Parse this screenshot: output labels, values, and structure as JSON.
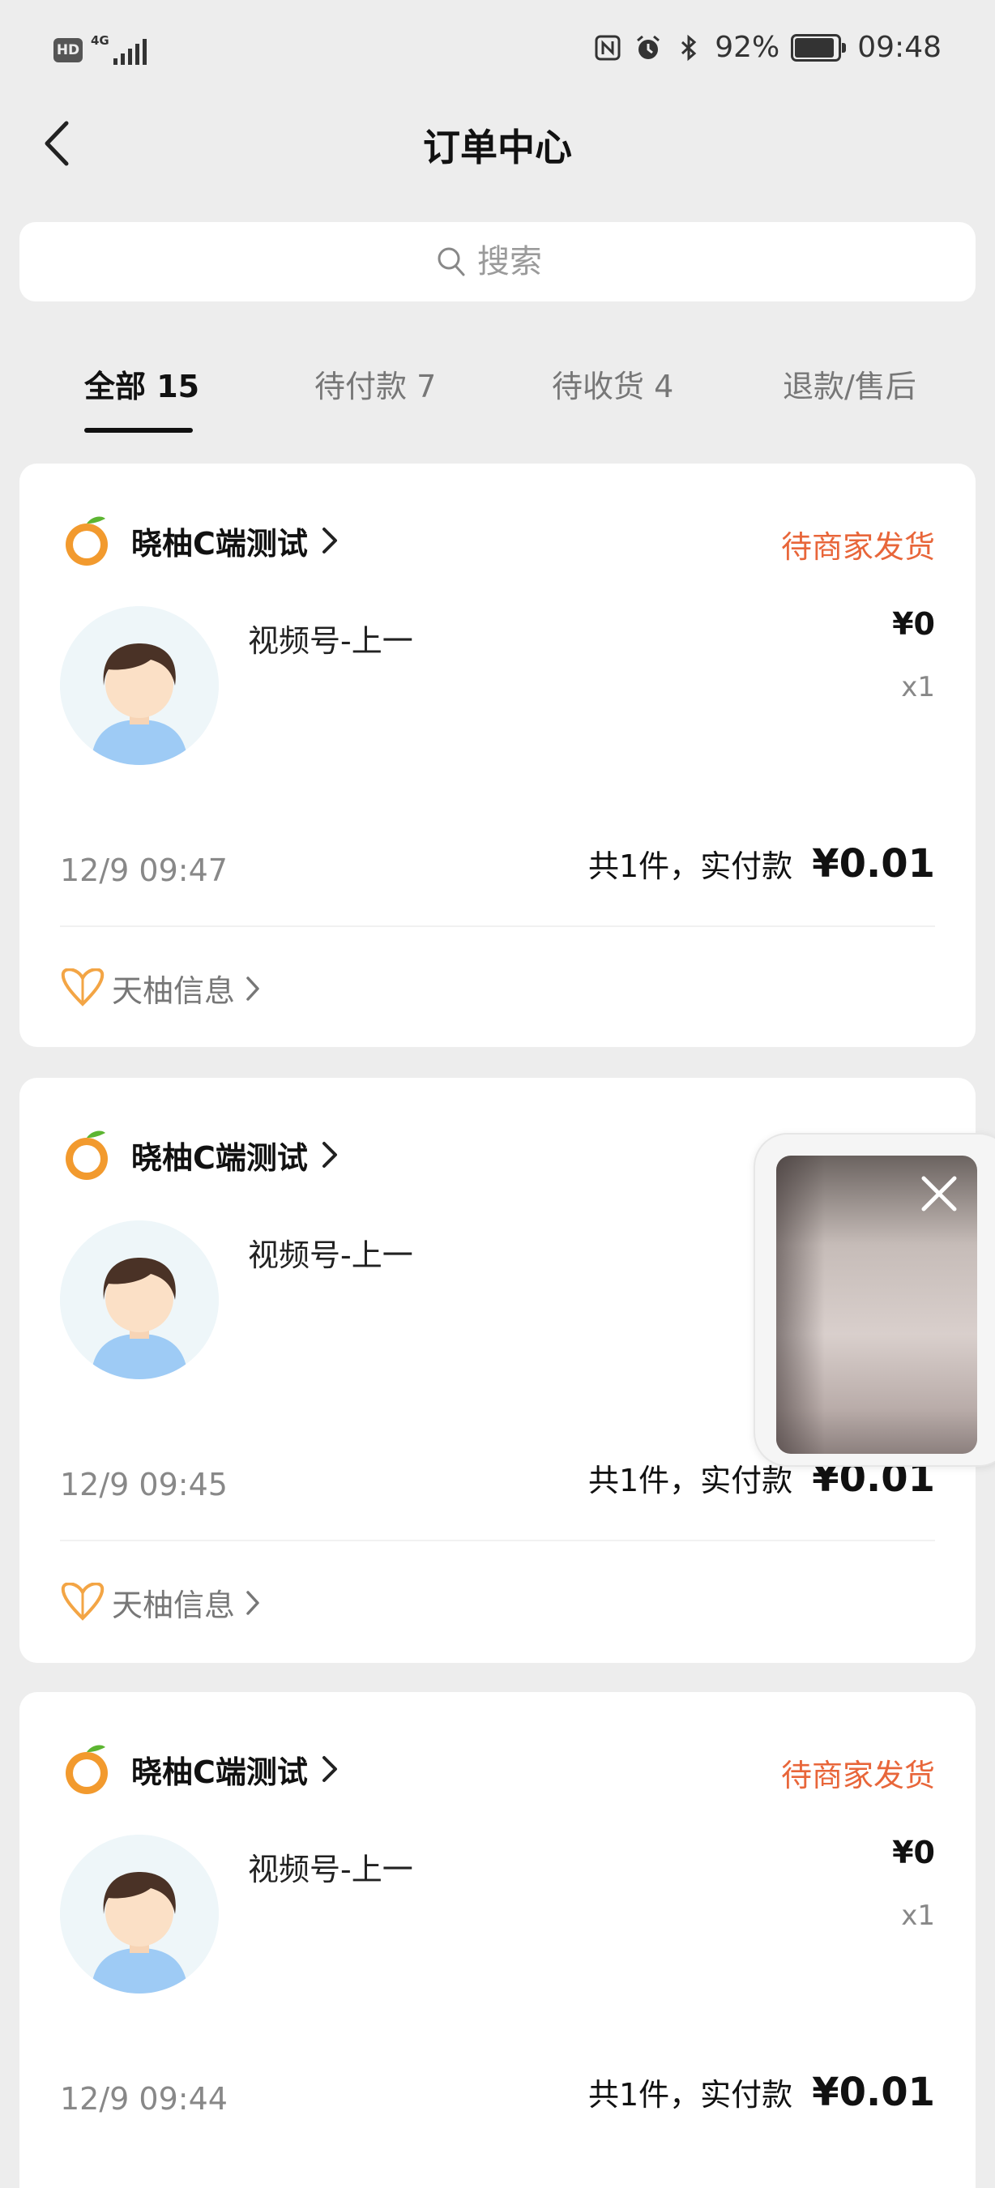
{
  "status_bar": {
    "hd": "HD",
    "network": "4G",
    "battery_text": "92%",
    "battery_level": 0.92,
    "time": "09:48",
    "icons": [
      "nfc-icon",
      "alarm-icon",
      "bluetooth-icon",
      "battery-icon"
    ]
  },
  "header": {
    "title": "订单中心",
    "back_icon": "chevron-left-icon"
  },
  "search": {
    "placeholder": "搜索",
    "icon": "search-icon"
  },
  "tabs": [
    {
      "label": "全部 15",
      "active": true
    },
    {
      "label": "待付款 7",
      "active": false
    },
    {
      "label": "待收货 4",
      "active": false
    },
    {
      "label": "退款/售后",
      "active": false
    }
  ],
  "colors": {
    "accent_status": "#e8663a",
    "merchant_logo": "#f3a545",
    "background": "#ededed"
  },
  "orders": [
    {
      "shop_name": "晓柚C端测试",
      "status": "待商家发货",
      "product_title": "视频号-上一",
      "price": "¥0",
      "quantity": "x1",
      "time": "12/9 09:47",
      "summary_text": "共1件，实付款",
      "total": "¥0.01",
      "merchant": "天柚信息"
    },
    {
      "shop_name": "晓柚C端测试",
      "status": "",
      "product_title": "视频号-上一",
      "price": "",
      "quantity": "",
      "time": "12/9 09:45",
      "summary_text": "共1件，实付款",
      "total": "¥0.01",
      "merchant": "天柚信息"
    },
    {
      "shop_name": "晓柚C端测试",
      "status": "待商家发货",
      "product_title": "视频号-上一",
      "price": "¥0",
      "quantity": "x1",
      "time": "12/9 09:44",
      "summary_text": "共1件，实付款",
      "total": "¥0.01",
      "merchant": ""
    }
  ],
  "floating_video": {
    "close_icon": "close-icon"
  }
}
